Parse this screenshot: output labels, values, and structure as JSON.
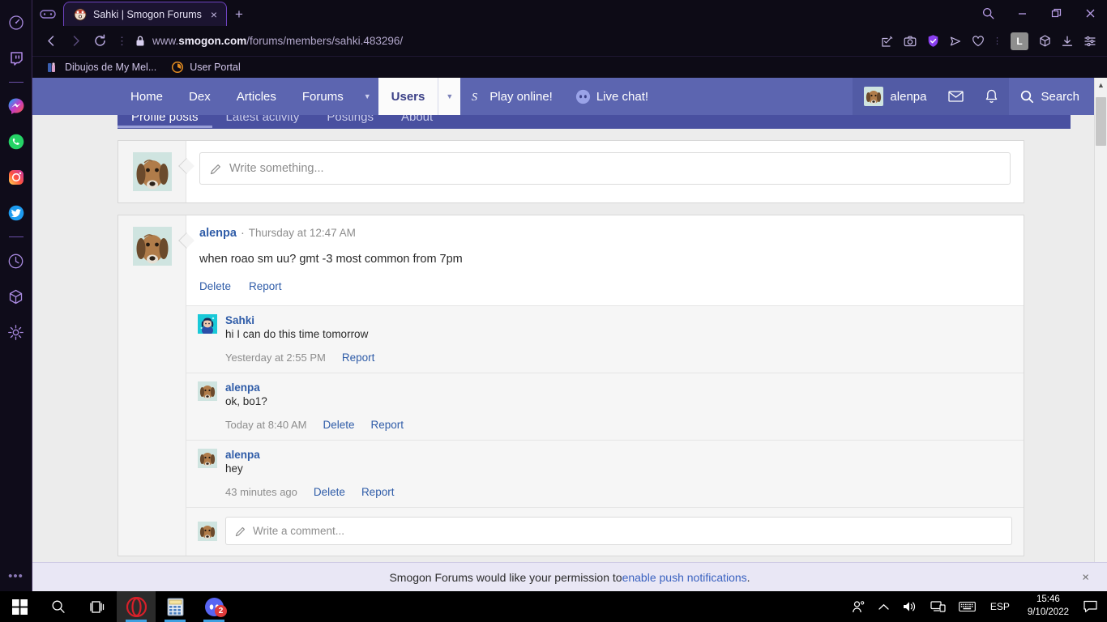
{
  "browser": {
    "tab": {
      "title": "Sahki | Smogon Forums",
      "favicon": "pokemon-icon",
      "close_label": "×"
    },
    "pinned_tab_icon": "gamepad-icon",
    "new_tab_label": "+",
    "url": {
      "prefix": "www.",
      "domain": "smogon.com",
      "path": "/forums/members/sahki.483296/"
    },
    "nav": {
      "back": "back-icon",
      "forward": "forward-icon",
      "reload": "reload-icon",
      "menu_dots": "⋮",
      "lock": "lock-icon"
    },
    "toolbar_icons": [
      "edit-icon",
      "snapshot-icon",
      "vpn-shield-icon",
      "send-icon",
      "heart-icon"
    ],
    "profile_badge": "L",
    "toolbar_icons_right": [
      "extensions-icon",
      "downloads-icon",
      "easy-setup-icon"
    ],
    "window": {
      "search": "search-icon",
      "minimize": "minimize-icon",
      "restore": "restore-icon",
      "close": "close-icon"
    },
    "bookmarks": [
      {
        "label": "Dibujos de My Mel...",
        "icon": "bookmark-favicon"
      },
      {
        "label": "User Portal",
        "icon": "user-portal-favicon"
      }
    ],
    "sidebar_icons": [
      "speed-dial-icon",
      "twitch-icon",
      "divider",
      "messenger-icon",
      "whatsapp-icon",
      "instagram-icon",
      "twitter-icon",
      "divider",
      "history-icon",
      "extensions-cube-icon",
      "settings-gear-icon"
    ],
    "sidebar_more": "•••"
  },
  "site": {
    "nav_items": [
      {
        "label": "Home",
        "active": false,
        "caret": false
      },
      {
        "label": "Dex",
        "active": false,
        "caret": false
      },
      {
        "label": "Articles",
        "active": false,
        "caret": false
      },
      {
        "label": "Forums",
        "active": false,
        "caret": true
      },
      {
        "label": "Users",
        "active": true,
        "caret": true
      }
    ],
    "play_online": {
      "label": "Play online!",
      "icon": "pokemon-showdown-icon"
    },
    "live_chat": {
      "label": "Live chat!",
      "icon": "discord-icon"
    },
    "user": {
      "name": "alenpa",
      "avatar": "dog-avatar"
    },
    "inbox_icon": "envelope-icon",
    "alerts_icon": "bell-icon",
    "search": {
      "label": "Search",
      "icon": "search-icon"
    },
    "subtabs": [
      {
        "label": "Profile posts",
        "active": true
      },
      {
        "label": "Latest activity",
        "active": false
      },
      {
        "label": "Postings",
        "active": false
      },
      {
        "label": "About",
        "active": false
      }
    ]
  },
  "composer": {
    "placeholder": "Write something...",
    "avatar": "dog-avatar",
    "pencil_icon": "pencil-icon"
  },
  "post": {
    "avatar": "dog-avatar",
    "author": "alenpa",
    "separator": "·",
    "date": "Thursday at 12:47 AM",
    "body": "when roao sm uu? gmt -3 most common from 7pm",
    "actions": [
      "Delete",
      "Report"
    ],
    "comments": [
      {
        "avatar": "sahki-avatar",
        "author": "Sahki",
        "text": "hi I can do this time tomorrow",
        "time": "Yesterday at 2:55 PM",
        "actions": [
          "Report"
        ]
      },
      {
        "avatar": "dog-avatar",
        "author": "alenpa",
        "text": "ok, bo1?",
        "time": "Today at 8:40 AM",
        "actions": [
          "Delete",
          "Report"
        ]
      },
      {
        "avatar": "dog-avatar",
        "author": "alenpa",
        "text": "hey",
        "time": "43 minutes ago",
        "actions": [
          "Delete",
          "Report"
        ]
      }
    ],
    "comment_box": {
      "placeholder": "Write a comment...",
      "avatar": "dog-avatar",
      "pencil_icon": "pencil-icon"
    }
  },
  "push_notification": {
    "text_before": "Smogon Forums would like your permission to ",
    "link": "enable push notifications",
    "text_after": ".",
    "close": "×"
  },
  "taskbar": {
    "items": [
      {
        "name": "start-button",
        "icon": "windows-logo-icon"
      },
      {
        "name": "search-button",
        "icon": "magnifier-icon"
      },
      {
        "name": "task-view-button",
        "icon": "task-view-icon"
      },
      {
        "name": "opera-taskbar-button",
        "icon": "opera-icon",
        "active": true,
        "running": true
      },
      {
        "name": "calculator-taskbar-button",
        "icon": "calculator-icon",
        "running": true
      },
      {
        "name": "discord-taskbar-button",
        "icon": "discord-icon",
        "running": true,
        "badge": "2"
      }
    ],
    "tray": {
      "people_icon": "people-icon",
      "chevron_icon": "show-hidden-icons",
      "volume_icon": "volume-icon",
      "network_icon": "network-icon",
      "keyboard_icon": "touch-keyboard-icon",
      "language": "ESP",
      "time": "15:46",
      "date": "9/10/2022",
      "action_center_icon": "action-center-icon"
    }
  },
  "colors": {
    "opera_chrome": "#0d0b16",
    "tab_border": "#6e43c0",
    "smogon_nav": "#5c65b0",
    "smogon_subnav": "#4950a0",
    "link_blue": "#2f5ca8",
    "push_bar": "#e9e7f5"
  }
}
